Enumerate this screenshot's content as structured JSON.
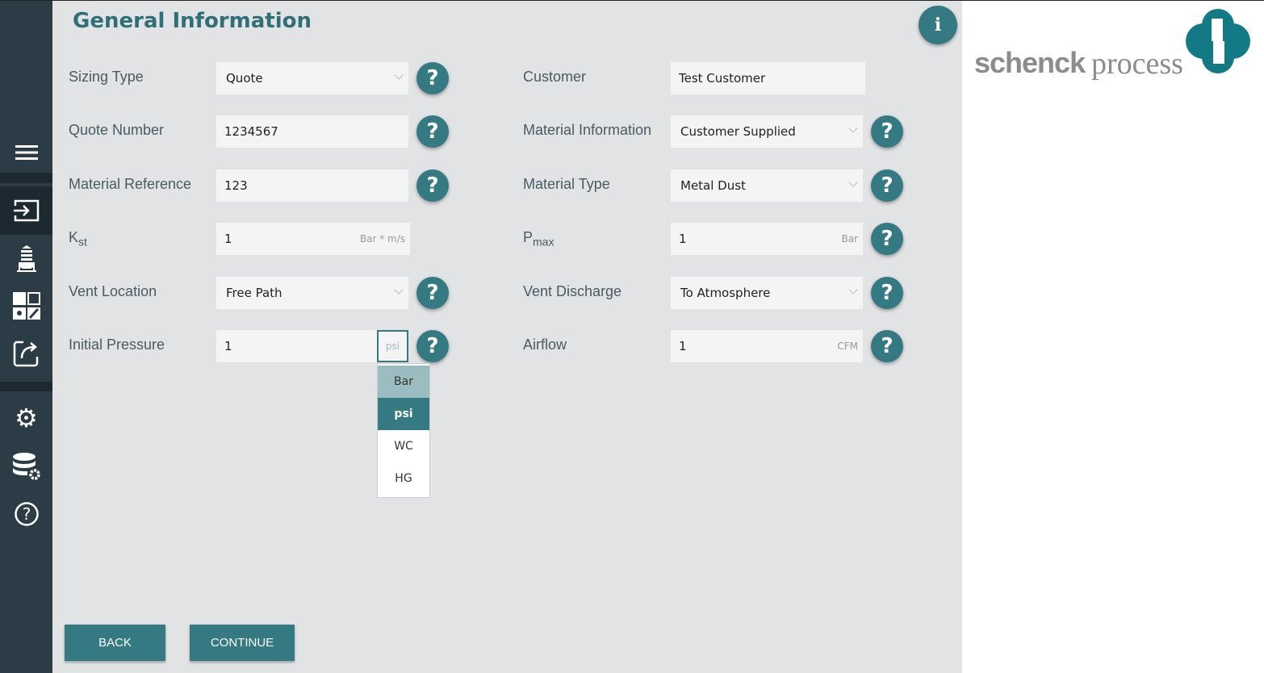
{
  "sidebar": {
    "items": [
      {
        "icon": "hamburger-menu-icon"
      },
      {
        "icon": "input-icon",
        "active": true
      },
      {
        "icon": "silo-icon"
      },
      {
        "icon": "grid-icon"
      },
      {
        "icon": "export-icon"
      },
      {
        "icon": "gear-icon"
      },
      {
        "icon": "database-settings-icon"
      },
      {
        "icon": "help-circle-icon"
      }
    ]
  },
  "header": {
    "title": "General Information",
    "info": "i"
  },
  "left": [
    {
      "label": "Sizing Type",
      "value": "Quote",
      "type": "select"
    },
    {
      "label": "Quote Number",
      "value": "1234567",
      "type": "input"
    },
    {
      "label": "Material Reference",
      "value": "123",
      "type": "input"
    },
    {
      "label": "K",
      "sub": "st",
      "value": "1",
      "unit": "Bar * m/s",
      "type": "input"
    },
    {
      "label": "Vent Location",
      "value": "Free Path",
      "type": "select"
    },
    {
      "label": "Initial Pressure",
      "value": "1",
      "unit": "psi",
      "type": "input-unit"
    }
  ],
  "right": [
    {
      "label": "Customer",
      "value": "Test Customer",
      "type": "input"
    },
    {
      "label": "Material Information",
      "value": "Customer Supplied",
      "type": "select"
    },
    {
      "label": "Material Type",
      "value": "Metal Dust",
      "type": "select"
    },
    {
      "label": "P",
      "sub": "max",
      "value": "1",
      "unit": "Bar",
      "type": "input"
    },
    {
      "label": "Vent Discharge",
      "value": "To Atmosphere",
      "type": "select"
    },
    {
      "label": "Airflow",
      "value": "1",
      "unit": "CFM",
      "type": "input"
    }
  ],
  "help": "?",
  "unit_dropdown": {
    "options": [
      "Bar",
      "psi",
      "WC",
      "HG"
    ],
    "selected": "psi",
    "hovered": "Bar"
  },
  "buttons": {
    "back": "BACK",
    "continue": "CONTINUE"
  },
  "logo": {
    "text1": "schenck",
    "text2": "process"
  },
  "colors": {
    "accent": "#357982",
    "sidebar": "#2c3c47"
  }
}
